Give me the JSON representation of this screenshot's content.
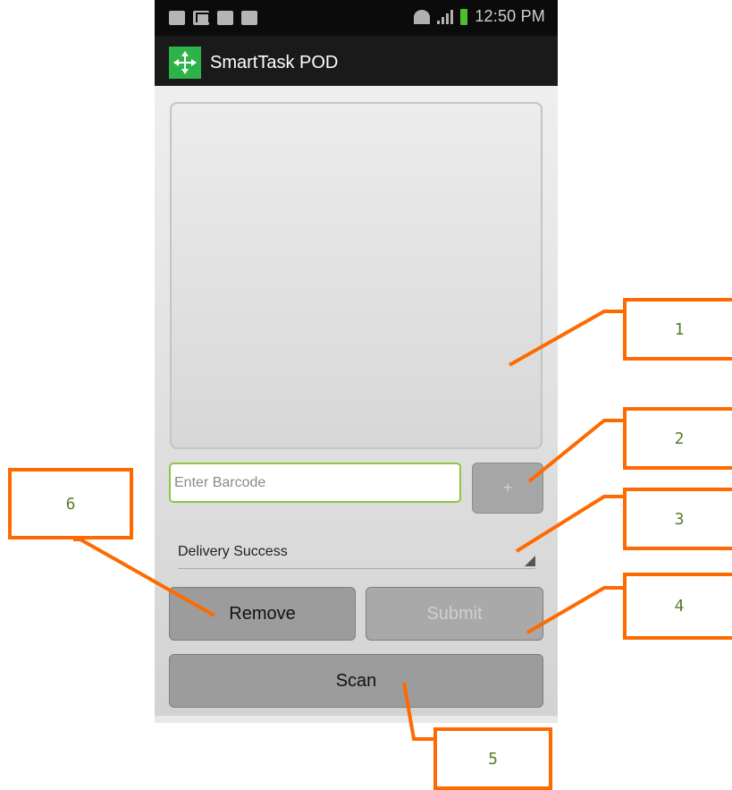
{
  "status_bar": {
    "time": "12:50 PM"
  },
  "action_bar": {
    "title": "SmartTask POD"
  },
  "barcode_field": {
    "placeholder": "Enter Barcode",
    "value": ""
  },
  "add_button": {
    "label": "+"
  },
  "status_select": {
    "selected": "Delivery Success"
  },
  "buttons": {
    "remove": "Remove",
    "submit": "Submit",
    "scan": "Scan"
  },
  "callouts": {
    "c1": "1",
    "c2": "2",
    "c3": "3",
    "c4": "4",
    "c5": "5",
    "c6": "6"
  },
  "colors": {
    "accent": "#ff6a00",
    "app_logo": "#2db34a",
    "input_border": "#8ec63f",
    "callout_text": "#5a7a2a"
  }
}
